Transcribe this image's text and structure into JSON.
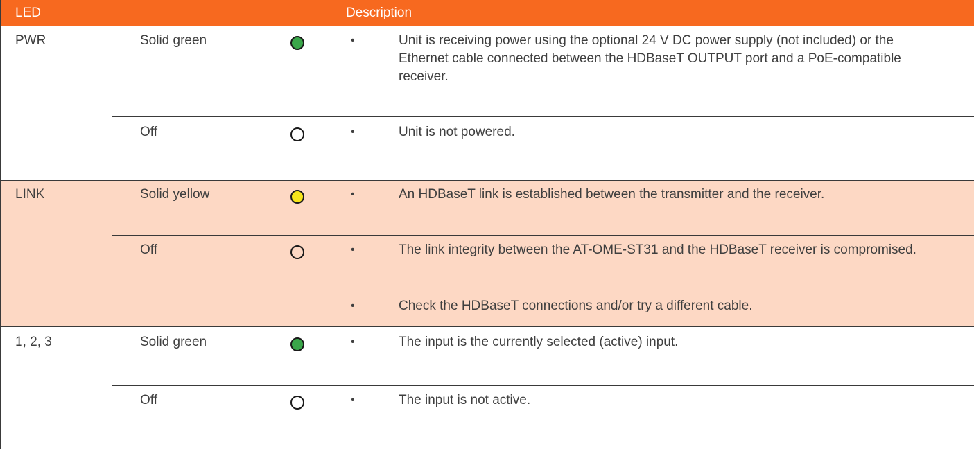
{
  "header": {
    "led_label": "LED",
    "description_label": "Description"
  },
  "colors": {
    "header_bg": "#f7691f",
    "shaded_row": "#fdd8c4",
    "led_green": "#3aa64a",
    "led_yellow": "#f7e51a",
    "led_off": "#ffffff"
  },
  "groups": [
    {
      "led": "PWR",
      "rows": [
        {
          "state": "Solid green",
          "indicator": "green",
          "descriptions": [
            "Unit is receiving power using the optional 24 V DC power supply (not included) or the Ethernet cable connected between the HDBaseT OUTPUT port and a PoE-compatible receiver."
          ]
        },
        {
          "state": "Off",
          "indicator": "off",
          "descriptions": [
            "Unit is not powered."
          ]
        }
      ]
    },
    {
      "led": "LINK",
      "rows": [
        {
          "state": "Solid yellow",
          "indicator": "yellow",
          "descriptions": [
            "An HDBaseT link is established between the transmitter and the receiver."
          ]
        },
        {
          "state": "Off",
          "indicator": "off",
          "descriptions": [
            "The link integrity between the AT-OME-ST31 and the HDBaseT receiver is compromised.",
            "Check the HDBaseT connections and/or try a different cable."
          ]
        }
      ]
    },
    {
      "led": "1, 2, 3",
      "rows": [
        {
          "state": "Solid green",
          "indicator": "green",
          "descriptions": [
            "The input is the currently selected (active) input."
          ]
        },
        {
          "state": "Off",
          "indicator": "off",
          "descriptions": [
            "The input is not active."
          ]
        }
      ]
    }
  ]
}
